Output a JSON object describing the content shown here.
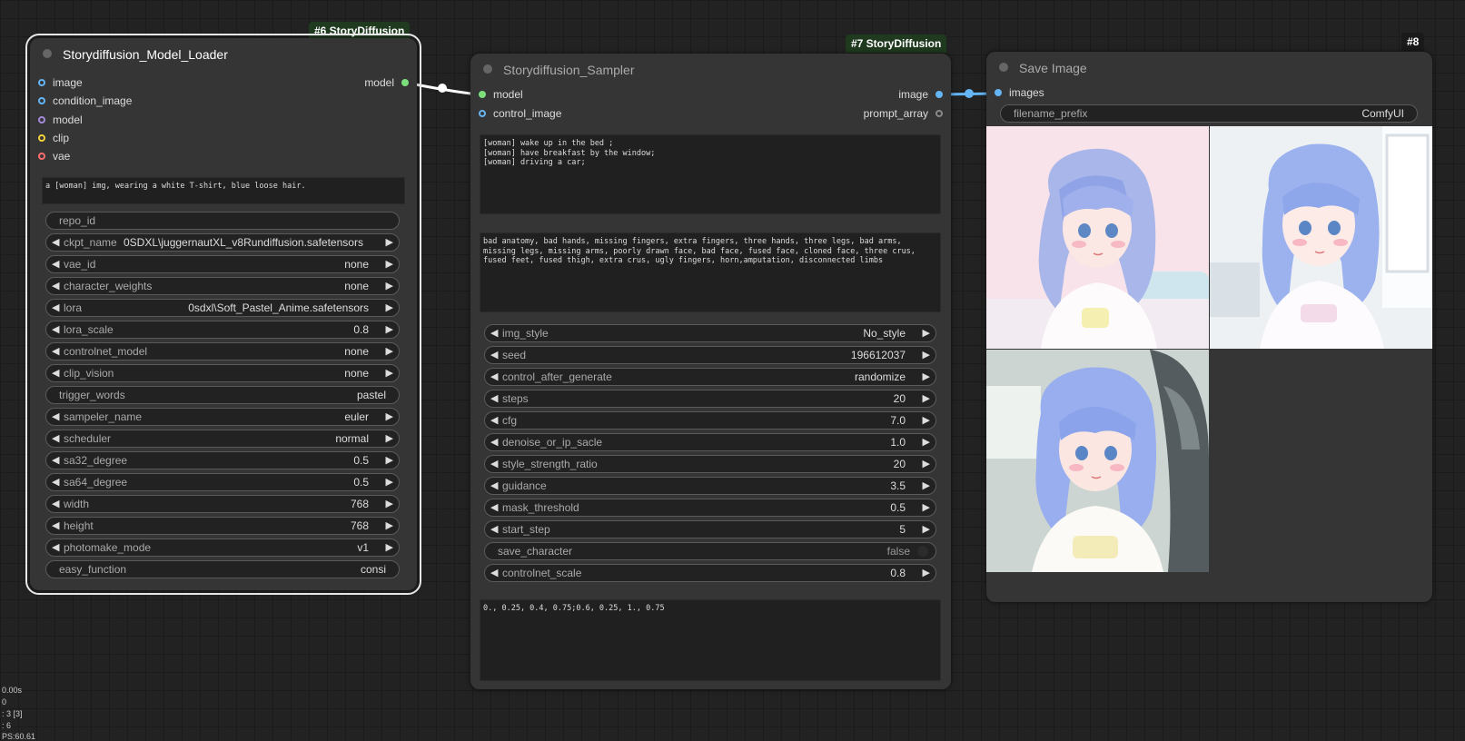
{
  "colors": {
    "model": "#7be07b",
    "image": "#64b5f6",
    "condition_image": "#64b5f6",
    "control_image": "#64b5f6",
    "clip_vision": "#a38bd9",
    "clip": "#f2d33c",
    "vae": "#ff6e6e",
    "prompt_array": "#888888",
    "badge_bg": "#1f3a1f"
  },
  "loader": {
    "badge": "#6 StoryDiffusion",
    "title": "Storydiffusion_Model_Loader",
    "inputs": [
      {
        "label": "image",
        "icon": "slot-dot-blue"
      },
      {
        "label": "condition_image",
        "icon": "slot-dot-blue"
      },
      {
        "label": "model",
        "icon": "slot-dot-purple"
      },
      {
        "label": "clip",
        "icon": "slot-dot-yellow"
      },
      {
        "label": "vae",
        "icon": "slot-dot-red"
      }
    ],
    "output": "model",
    "prompt": "a [woman] img, wearing a white T-shirt, blue loose hair.",
    "widgets": {
      "repo_id": {
        "label": "repo_id",
        "value": ""
      },
      "ckpt_name": {
        "label": "ckpt_name",
        "value": "0SDXL\\juggernautXL_v8Rundiffusion.safetensors"
      },
      "vae_id": {
        "label": "vae_id",
        "value": "none"
      },
      "character_weights": {
        "label": "character_weights",
        "value": "none"
      },
      "lora": {
        "label": "lora",
        "value": "0sdxl\\Soft_Pastel_Anime.safetensors"
      },
      "lora_scale": {
        "label": "lora_scale",
        "value": "0.8"
      },
      "controlnet_model": {
        "label": "controlnet_model",
        "value": "none"
      },
      "clip_vision": {
        "label": "clip_vision",
        "value": "none"
      },
      "trigger_words": {
        "label": "trigger_words",
        "value": "pastel"
      },
      "sampeler_name": {
        "label": "sampeler_name",
        "value": "euler"
      },
      "scheduler": {
        "label": "scheduler",
        "value": "normal"
      },
      "sa32_degree": {
        "label": "sa32_degree",
        "value": "0.5"
      },
      "sa64_degree": {
        "label": "sa64_degree",
        "value": "0.5"
      },
      "width": {
        "label": "width",
        "value": "768"
      },
      "height": {
        "label": "height",
        "value": "768"
      },
      "photomake_mode": {
        "label": "photomake_mode",
        "value": "v1"
      },
      "easy_function": {
        "label": "easy_function",
        "value": "consi"
      }
    }
  },
  "sampler": {
    "badge": "#7 StoryDiffusion",
    "title": "Storydiffusion_Sampler",
    "inputs": [
      {
        "label": "model",
        "icon": "slot-dot-green"
      },
      {
        "label": "control_image",
        "icon": "slot-dot-blue"
      }
    ],
    "outputs": [
      {
        "label": "image",
        "icon": "slot-dot-blue"
      },
      {
        "label": "prompt_array",
        "icon": "slot-dot-gray"
      }
    ],
    "prompt": "[woman] wake up in the bed ;\n[woman] have breakfast by the window;\n[woman] driving a car;",
    "negative": "bad anatomy, bad hands, missing fingers, extra fingers, three hands, three legs, bad arms, missing legs, missing arms, poorly drawn face, bad face, fused face, cloned face, three crus, fused feet, fused thigh, extra crus, ugly fingers, horn,amputation, disconnected limbs",
    "widgets": {
      "img_style": {
        "label": "img_style",
        "value": "No_style"
      },
      "seed": {
        "label": "seed",
        "value": "196612037"
      },
      "control_after_generate": {
        "label": "control_after_generate",
        "value": "randomize"
      },
      "steps": {
        "label": "steps",
        "value": "20"
      },
      "cfg": {
        "label": "cfg",
        "value": "7.0"
      },
      "denoise_or_ip_sacle": {
        "label": "denoise_or_ip_sacle",
        "value": "1.0"
      },
      "style_strength_ratio": {
        "label": "style_strength_ratio",
        "value": "20"
      },
      "guidance": {
        "label": "guidance",
        "value": "3.5"
      },
      "mask_threshold": {
        "label": "mask_threshold",
        "value": "0.5"
      },
      "start_step": {
        "label": "start_step",
        "value": "5"
      },
      "save_character": {
        "label": "save_character",
        "value": "false"
      },
      "controlnet_scale": {
        "label": "controlnet_scale",
        "value": "0.8"
      }
    },
    "extra_text": "0., 0.25, 0.4, 0.75;0.6, 0.25, 1., 0.75"
  },
  "save": {
    "badge": "#8",
    "title": "Save Image",
    "input": "images",
    "filename_prefix": {
      "label": "filename_prefix",
      "value": "ComfyUI"
    },
    "images": [
      "anime girl in bed",
      "anime girl by window",
      "anime girl in car"
    ]
  },
  "stats": [
    "0.00s",
    "0",
    ": 3 [3]",
    ": 6",
    "PS:60.61"
  ]
}
